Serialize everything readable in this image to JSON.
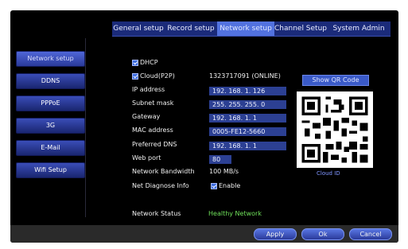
{
  "tabs": [
    "General setup",
    "Record setup",
    "Network setup",
    "Channel Setup",
    "System Admin"
  ],
  "sidebar": [
    "Network setup",
    "DDNS",
    "PPPoE",
    "3G",
    "E-Mail",
    "Wifi Setup"
  ],
  "form": {
    "dhcp_label": "DHCP",
    "cloud_label": "Cloud(P2P)",
    "cloud_value": "1323717091  (ONLINE)",
    "show_qr_label": "Show QR Code",
    "ip_label": "IP address",
    "ip_value": "192. 168.   1. 126",
    "subnet_label": "Subnet mask",
    "subnet_value": "255. 255. 255.   0",
    "gateway_label": "Gateway",
    "gateway_value": "192. 168.   1.   1",
    "mac_label": "MAC address",
    "mac_value": "0005-FE12-5660",
    "dns_label": "Preferred DNS",
    "dns_value": "192. 168.   1.   1",
    "webport_label": "Web port",
    "webport_value": "80",
    "bandwidth_label": "Network Bandwidth",
    "bandwidth_value": "100     MB/s",
    "diagnose_label": "Net Diagnose Info",
    "diagnose_value": "Enable",
    "cloud_id_caption": "Cloud ID",
    "status_label": "Network Status",
    "status_value": "Healthy Network"
  },
  "buttons": {
    "apply": "Apply",
    "ok": "Ok",
    "cancel": "Cancel"
  },
  "colors": {
    "tab_bar": "#1b2b7a",
    "active_tab": "#5272df",
    "status_ok": "#6fe15a",
    "accent": "#3a5ac8"
  }
}
